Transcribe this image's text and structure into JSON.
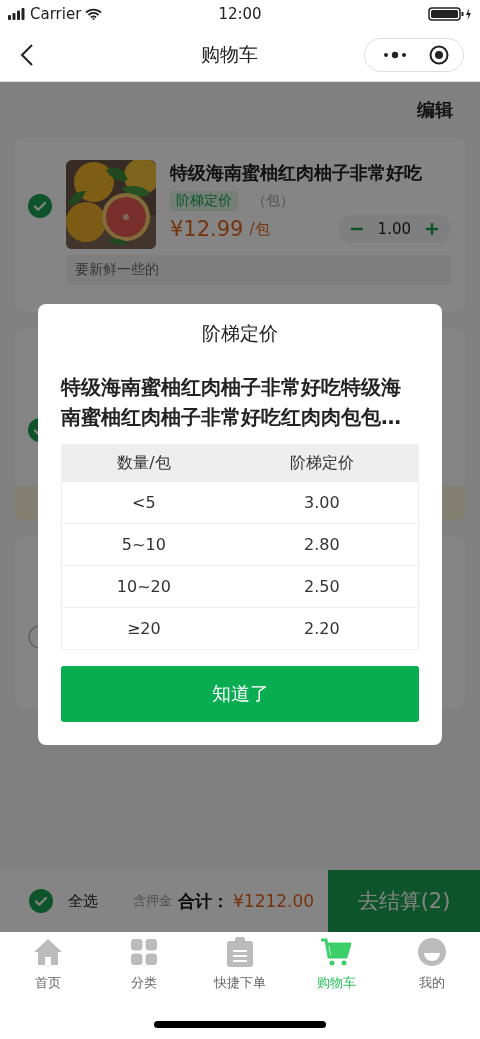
{
  "status_bar": {
    "carrier": "Carrier",
    "time": "12:00"
  },
  "nav_bar": {
    "title": "购物车"
  },
  "edit_link": "编辑",
  "cart_items": [
    {
      "name": "特级海南蜜柚红肉柚子非常好吃",
      "tag": "阶梯定价",
      "unit_note": "（包）",
      "price": "¥12.99",
      "unit": "/包",
      "quantity": "1.00",
      "remark": "要新鲜一些的",
      "checked": true
    },
    {
      "checked": true,
      "notice": true
    },
    {
      "checked": false
    }
  ],
  "modal": {
    "title": "阶梯定价",
    "description": "特级海南蜜柚红肉柚子非常好吃特级海南蜜柚红肉柚子非常好吃红肉肉包包…",
    "columns": [
      "数量/包",
      "阶梯定价"
    ],
    "rows": [
      [
        "<5",
        "3.00"
      ],
      [
        "5~10",
        "2.80"
      ],
      [
        "10~20",
        "2.50"
      ],
      [
        "≥20",
        "2.20"
      ]
    ],
    "button": "知道了"
  },
  "footer": {
    "select_all": {
      "label": "全选",
      "checked": true
    },
    "deposit_note": "含押金",
    "total_label": "合计：",
    "total": "¥1212.00",
    "checkout": "去结算(2)"
  },
  "tab_bar": [
    {
      "label": "首页",
      "kind": "home",
      "selected": false
    },
    {
      "label": "分类",
      "kind": "grid",
      "selected": false
    },
    {
      "label": "快捷下单",
      "kind": "clipboard",
      "selected": false
    },
    {
      "label": "购物车",
      "kind": "cart",
      "selected": true
    },
    {
      "label": "我的",
      "kind": "profile",
      "selected": false
    }
  ]
}
